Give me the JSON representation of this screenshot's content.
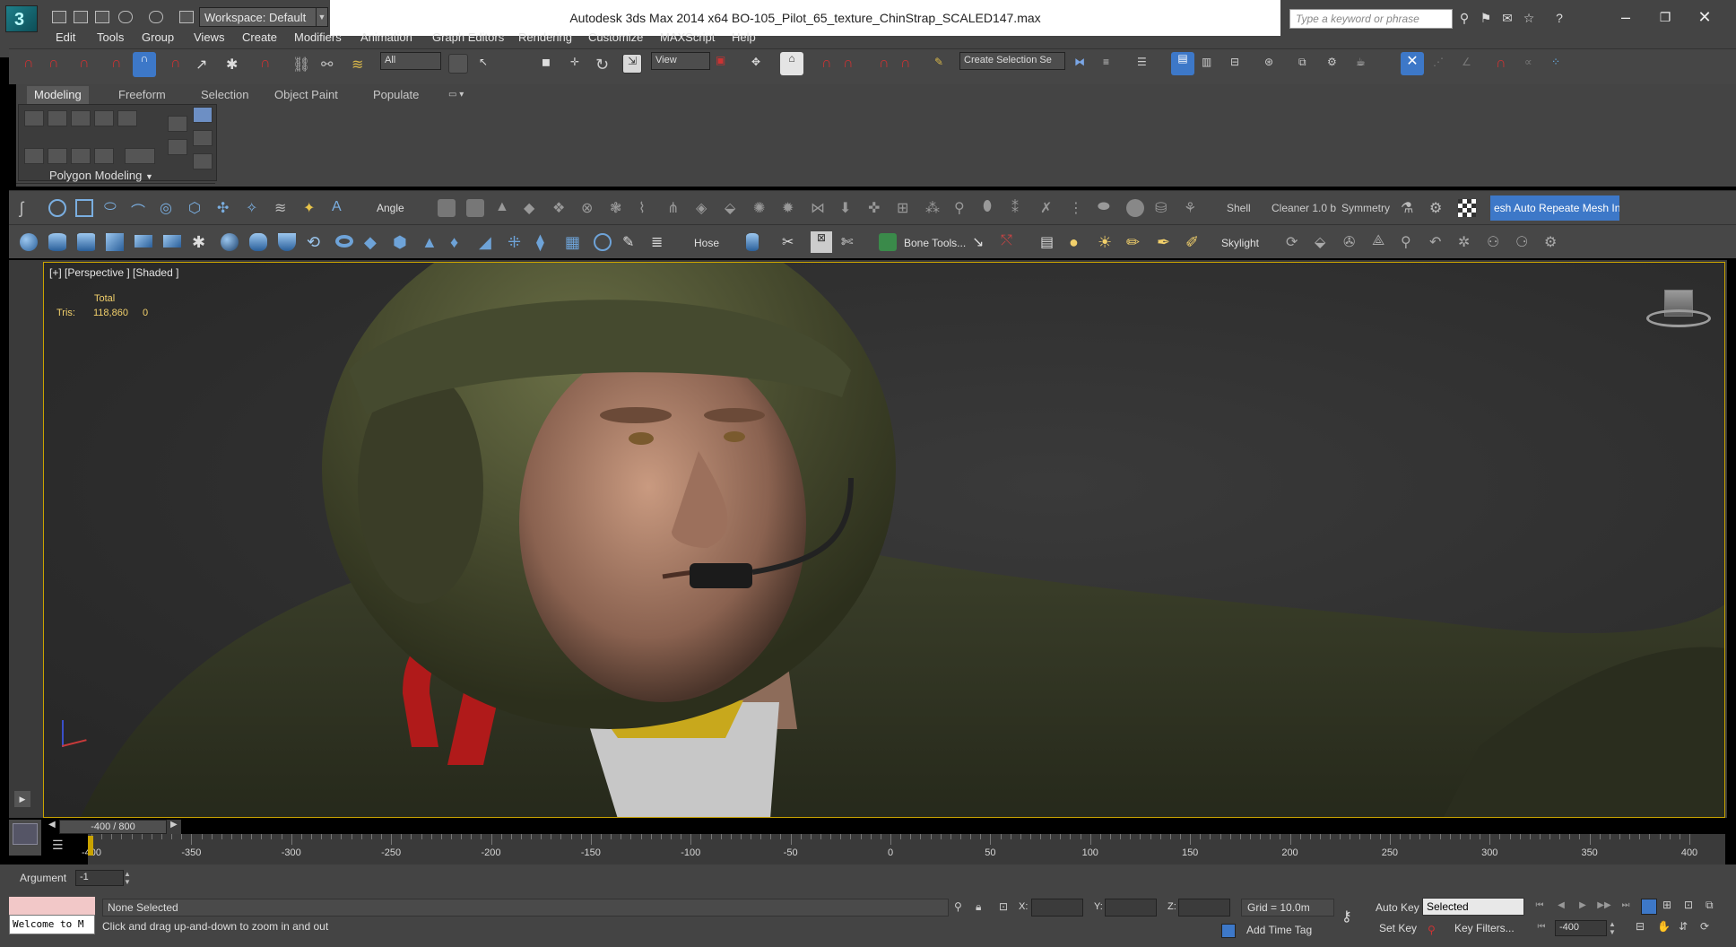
{
  "titlebar": {
    "workspace_label": "Workspace: Default",
    "window_title": "Autodesk 3ds Max  2014 x64     BO-105_Pilot_65_texture_ChinStrap_SCALED147.max",
    "search_placeholder": "Type a keyword or phrase"
  },
  "menu": {
    "items": [
      "Edit",
      "Tools",
      "Group",
      "Views",
      "Create",
      "Modifiers",
      "Animation",
      "Graph Editors",
      "Rendering",
      "Customize",
      "MAXScript",
      "Help"
    ]
  },
  "main_toolbar": {
    "selection_filter": "All",
    "reference_coord": "View",
    "named_selection": "Create Selection Se"
  },
  "ribbon": {
    "tabs": [
      "Modeling",
      "Freeform",
      "Selection",
      "Object Paint",
      "Populate"
    ],
    "active_tab": "Modeling",
    "panel_label": "Polygon Modeling"
  },
  "toolbar2": {
    "angle_label": "Angle",
    "shell_label": "Shell",
    "cleaner_label": "Cleaner 1.0 b",
    "symmetry_label": "Symmetry",
    "mesh_label": "esh Auto Repeate Mesh Insp"
  },
  "toolbar3": {
    "hose_label": "Hose",
    "bone_tools_label": "Bone Tools...",
    "skylight_label": "Skylight"
  },
  "viewport": {
    "label": "[+] [Perspective ] [Shaded ]",
    "stats_total": "Total",
    "stats_tris_label": "Tris:",
    "stats_tris_value": "118,860",
    "stats_tris_selected": "0"
  },
  "timeline": {
    "slider_text": "-400 / 800",
    "tick_labels": [
      "-400",
      "-350",
      "-300",
      "-250",
      "-200",
      "-150",
      "-100",
      "-50",
      "0",
      "50",
      "100",
      "150",
      "200",
      "250",
      "300",
      "350",
      "400"
    ]
  },
  "status": {
    "argument_label": "Argument",
    "argument_value": "-1",
    "maxscript_listener": "Welcome to M",
    "selection_status": "None Selected",
    "prompt": "Click and drag up-and-down to zoom in and out",
    "x_label": "X:",
    "y_label": "Y:",
    "z_label": "Z:",
    "grid": "Grid = 10.0m",
    "add_time_tag": "Add Time Tag",
    "auto_key": "Auto Key",
    "set_key": "Set Key",
    "key_mode": "Selected",
    "key_filters": "Key Filters...",
    "current_frame": "-400"
  },
  "colors": {
    "ui_bg": "#444444",
    "viewport_border": "#c9a300",
    "stats_text": "#f2d06b",
    "active_blue": "#3d78c8"
  }
}
